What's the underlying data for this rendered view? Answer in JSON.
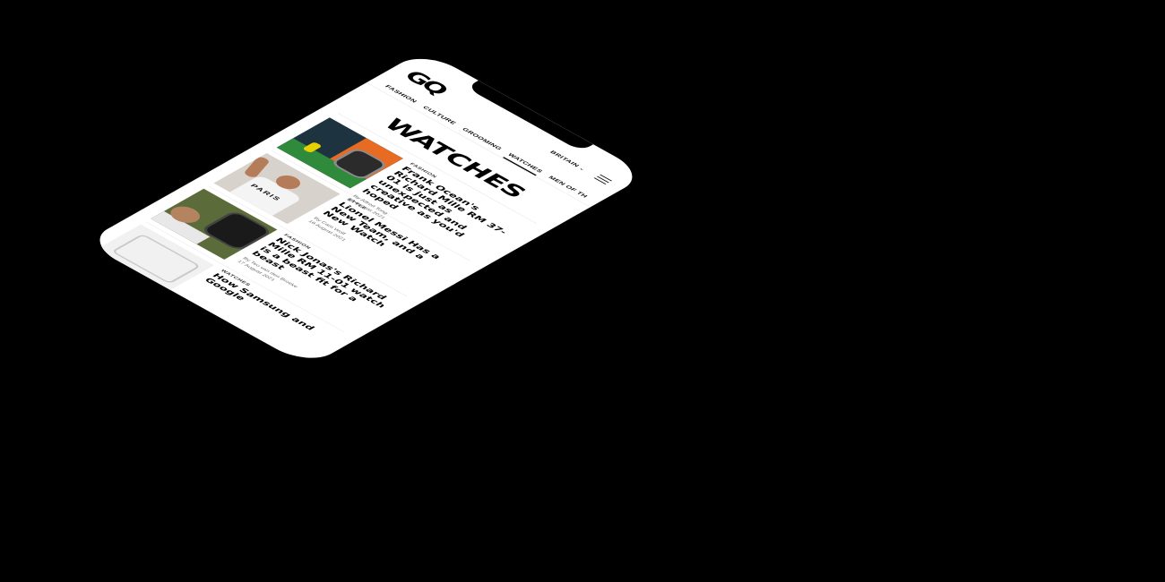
{
  "header": {
    "logo": "GQ",
    "region": "BRITAIN",
    "region_chevron": "chevron-down-icon",
    "menu_icon": "hamburger-menu-icon"
  },
  "nav": {
    "items": [
      {
        "label": "FASHION"
      },
      {
        "label": "CULTURE"
      },
      {
        "label": "GROOMING"
      },
      {
        "label": "WATCHES"
      },
      {
        "label": "MEN OF TH"
      }
    ],
    "active": "WATCHES"
  },
  "page": {
    "title": "WATCHES"
  },
  "articles": [
    {
      "rubric": "FASHION",
      "headline": "Frank Ocean's Richard Mille RM 37-01 is just as unexpected and creative as you'd hoped",
      "byline": "By Alfred Tong",
      "date": "18 August 2021"
    },
    {
      "rubric": "STYLE",
      "headline": "Lionel Messi Has a New Team, and a New Watch",
      "byline": "By Cam Wolf",
      "date": "18 August 2021"
    },
    {
      "rubric": "FASHION",
      "headline": "Nick Jonas's Richard Mille RM 11-01 watch is a beast fit for a beast",
      "byline": "By Teo van den Broeke",
      "date": "17 August 2021"
    },
    {
      "rubric": "WATCHES",
      "headline": "How Samsung and Google",
      "byline": "",
      "date": ""
    }
  ],
  "colors": {
    "background": "#000000",
    "screen": "#ffffff",
    "text": "#000000"
  }
}
